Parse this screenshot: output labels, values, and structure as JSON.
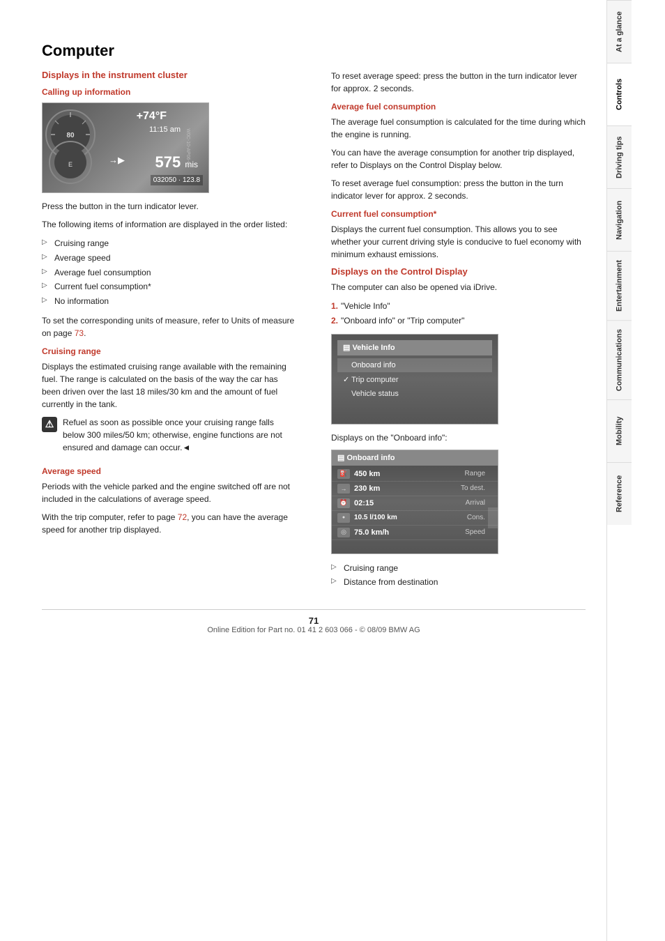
{
  "page": {
    "title": "Computer",
    "number": "71",
    "footer_text": "Online Edition for Part no. 01 41 2 603 066 - © 08/09 BMW AG"
  },
  "tabs": [
    {
      "id": "at-a-glance",
      "label": "At a glance",
      "active": false
    },
    {
      "id": "controls",
      "label": "Controls",
      "active": true
    },
    {
      "id": "driving-tips",
      "label": "Driving tips",
      "active": false
    },
    {
      "id": "navigation",
      "label": "Navigation",
      "active": false
    },
    {
      "id": "entertainment",
      "label": "Entertainment",
      "active": false
    },
    {
      "id": "communications",
      "label": "Communications",
      "active": false
    },
    {
      "id": "mobility",
      "label": "Mobility",
      "active": false
    },
    {
      "id": "reference",
      "label": "Reference",
      "active": false
    }
  ],
  "left_col": {
    "section_heading": "Displays in the instrument cluster",
    "sub_heading_calling": "Calling up information",
    "instrument_display": {
      "temp": "+74°F",
      "time": "11:15 am",
      "distance": "575",
      "distance_unit": "mis",
      "odometer": "032050 · 123.8",
      "watermark": "W0C-10-AP06-68"
    },
    "intro_text": "Press the button in the turn indicator lever.",
    "intro_text2": "The following items of information are displayed in the order listed:",
    "list_items": [
      "Cruising range",
      "Average speed",
      "Average fuel consumption",
      "Current fuel consumption*",
      "No information"
    ],
    "units_text": "To set the corresponding units of measure, refer to Units of measure on page",
    "units_page": "73",
    "cruising_range": {
      "heading": "Cruising range",
      "text": "Displays the estimated cruising range available with the remaining fuel. The range is calculated on the basis of the way the car has been driven over the last 18 miles/30 km and the amount of fuel currently in the tank."
    },
    "warning": {
      "text": "Refuel as soon as possible once your cruising range falls below 300 miles/50 km; otherwise, engine functions are not ensured and damage can occur.◄"
    },
    "average_speed": {
      "heading": "Average speed",
      "text1": "Periods with the vehicle parked and the engine switched off are not included in the calculations of average speed.",
      "text2": "With the trip computer, refer to page",
      "text2_page": "72",
      "text2_suffix": ", you can have the average speed for another trip displayed."
    }
  },
  "right_col": {
    "reset_speed_text": "To reset average speed: press the button in the turn indicator lever for approx. 2 seconds.",
    "average_fuel": {
      "heading": "Average fuel consumption",
      "text1": "The average fuel consumption is calculated for the time during which the engine is running.",
      "text2": "You can have the average consumption for another trip displayed, refer to Displays on the Control Display below.",
      "text3": "To reset average fuel consumption: press the button in the turn indicator lever for approx. 2 seconds."
    },
    "current_fuel": {
      "heading": "Current fuel consumption*",
      "text": "Displays the current fuel consumption. This allows you to see whether your current driving style is conducive to fuel economy with minimum exhaust emissions."
    },
    "control_display": {
      "heading": "Displays on the Control Display",
      "intro": "The computer can also be opened via iDrive.",
      "step1": "\"Vehicle Info\"",
      "step2": "\"Onboard info\" or \"Trip computer\"",
      "menu": {
        "header": "Vehicle Info",
        "items": [
          {
            "label": "Onboard info",
            "type": "normal"
          },
          {
            "label": "Trip computer",
            "type": "checked"
          },
          {
            "label": "Vehicle status",
            "type": "normal"
          }
        ]
      },
      "onboard_heading": "Displays on the \"Onboard info\":",
      "onboard_menu": {
        "header": "Onboard info",
        "rows": [
          {
            "icon": "fuel",
            "value": "450 km",
            "label": "Range"
          },
          {
            "icon": "arrow",
            "value": "230 km",
            "label": "To dest."
          },
          {
            "icon": "clock",
            "value": "02:15",
            "label": "Arrival"
          },
          {
            "icon": "gauge",
            "value": "10.5 l/100 km",
            "label": "Cons."
          },
          {
            "icon": "speed",
            "value": "75.0 km/h",
            "label": "Speed"
          }
        ]
      },
      "list_items": [
        "Cruising range",
        "Distance from destination"
      ]
    }
  }
}
